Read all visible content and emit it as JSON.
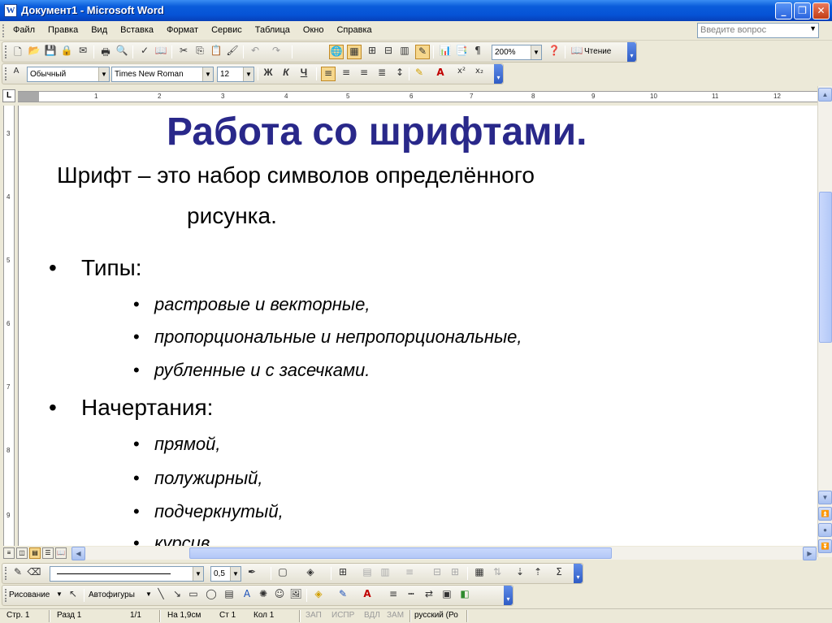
{
  "window": {
    "title": "Документ1 - Microsoft Word",
    "app_icon": "word-icon",
    "buttons": [
      "minimize",
      "restore",
      "close"
    ]
  },
  "menu": {
    "items": [
      "Файл",
      "Правка",
      "Вид",
      "Вставка",
      "Формат",
      "Сервис",
      "Таблица",
      "Окно",
      "Справка"
    ],
    "ask_placeholder": "Введите вопрос"
  },
  "standard_toolbar": {
    "zoom": "200%",
    "read_label": "Чтение"
  },
  "formatting_toolbar": {
    "style": "Обычный",
    "font": "Times New Roman",
    "size": "12",
    "bold": "Ж",
    "italic": "К",
    "underline": "Ч"
  },
  "ruler": {
    "h_numbers": [
      "1",
      "1",
      "2",
      "3",
      "4",
      "5",
      "6",
      "7",
      "8",
      "9",
      "10",
      "11",
      "12"
    ],
    "v_numbers": [
      "3",
      "4",
      "5",
      "6",
      "7",
      "8",
      "9"
    ]
  },
  "document": {
    "heading": "Работа со шрифтами.",
    "heading_color": "#29288a",
    "definition_line1": "Шрифт – это набор символов определённого",
    "definition_line2": "рисунка.",
    "types_label": "Типы:",
    "types": [
      "растровые и векторные,",
      "пропорциональные и непропорциональные,",
      "рубленные и с засечками."
    ],
    "styles_label": "Начертания:",
    "styles": [
      "прямой,",
      "полужирный,",
      "подчеркнутый,",
      "курсив."
    ],
    "bullet": "•"
  },
  "drawing_toolbar": {
    "line_width": "0,5",
    "draw_label": "Рисование",
    "autoshapes_label": "Автофигуры"
  },
  "status": {
    "page": "Стр. 1",
    "section": "Разд 1",
    "pages": "1/1",
    "at": "На 1,9см",
    "line": "Ст 1",
    "col": "Кол 1",
    "rec": "ЗАП",
    "trk": "ИСПР",
    "ext": "ВДЛ",
    "ovr": "ЗАМ",
    "language": "русский (Ро"
  }
}
